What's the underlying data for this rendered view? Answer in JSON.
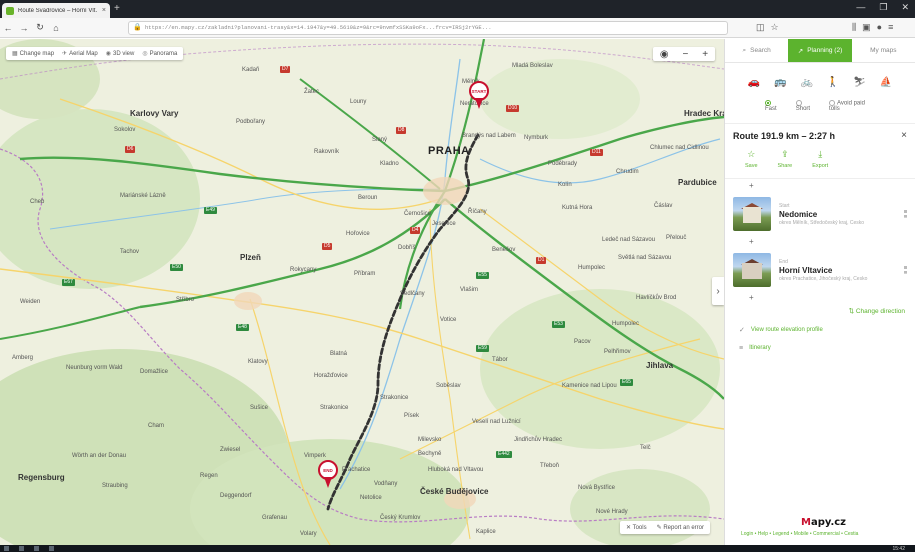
{
  "browser": {
    "tab_title": "Route Švadrovice – Horní Vlt…",
    "close_tab": "×",
    "new_tab": "+",
    "url": "https://en.mapy.cz/zakladni?planovani-trasy&x=14.1947&y=49.5610&z=9&rc=9nvmfxSSKa9oFx...frcv=IRSj2rYGE...",
    "window_controls": [
      "—",
      "❐",
      "✕"
    ]
  },
  "map": {
    "toolbar": [
      {
        "icon": "▦",
        "label": "Change map"
      },
      {
        "icon": "✈",
        "label": "Aerial Map"
      },
      {
        "icon": "◉",
        "label": "3D view"
      },
      {
        "icon": "◎",
        "label": "Panorama"
      }
    ],
    "zoom": {
      "layers": "◉",
      "minus": "−",
      "plus": "+"
    },
    "collapse_arrow": "›",
    "bottom_tools": [
      {
        "icon": "✕",
        "label": "Tools"
      },
      {
        "icon": "✎",
        "label": "Report an error"
      }
    ],
    "pins": {
      "start": "START",
      "end": "END"
    },
    "capital": "PRAHA",
    "cities": [
      {
        "name": "Karlovy Vary"
      },
      {
        "name": "Plzeň"
      },
      {
        "name": "České Budějovice"
      },
      {
        "name": "Jihlava"
      },
      {
        "name": "Pardubice"
      },
      {
        "name": "Hradec Králové"
      },
      {
        "name": "Regensburg"
      }
    ],
    "places": [
      "Kadaň",
      "Žatec",
      "Louny",
      "Slaný",
      "Kladno",
      "Rakovník",
      "Beroun",
      "Příbram",
      "Písek",
      "Strakonice",
      "Klatovy",
      "Domažlice",
      "Sušice",
      "Tábor",
      "Benešov",
      "Kolín",
      "Kutná Hora",
      "Pelhřimov",
      "Jindřichův Hradec",
      "Mladá Boleslav",
      "Mělník",
      "Neratovice",
      "Brandýs nad Labem",
      "Podbořany",
      "Sokolov",
      "Cheb",
      "Mariánské Lázně",
      "Tachov",
      "Stříbro",
      "Rokycany",
      "Horažďovice",
      "Vimperk",
      "Prachatice",
      "Strakonice",
      "Blatná",
      "Vlašim",
      "Votice",
      "Sedlčany",
      "Dobříš",
      "Nymburk",
      "Poděbrady",
      "Chrudim",
      "Havlíčkův Brod",
      "Humpolec",
      "Pacov",
      "Kamenice nad Lipou",
      "Soběslav",
      "Veselí nad Lužnicí",
      "Třeboň",
      "Nové Hrady",
      "Český Krumlov",
      "Weiden",
      "Amberg",
      "Cham",
      "Straubing",
      "Deggendorf",
      "Neunburg vorm Wald",
      "Wörth an der Donau",
      "Zwiesel",
      "Regen",
      "Grafenau",
      "Hořovice",
      "Jesenice",
      "Černošice",
      "Říčany",
      "Vodňany",
      "Milevsko",
      "Bechyně",
      "Hluboká nad Vltavou",
      "Netolice",
      "Volary",
      "Kaplice",
      "Nová Bystřice",
      "Telč",
      "Humpolec",
      "Světlá nad Sázavou",
      "Ledeč nad Sázavou",
      "Čáslav",
      "Přelouč",
      "Chlumec nad Cidlinou"
    ],
    "roads": [
      "D7",
      "D8",
      "D5",
      "D1",
      "D4",
      "D6",
      "D10",
      "D11",
      "E49",
      "E50",
      "E48",
      "E55",
      "E53",
      "E59",
      "E65",
      "E442",
      "E67"
    ]
  },
  "panel": {
    "tabs": [
      {
        "icon": "⌕",
        "label": "Search"
      },
      {
        "icon": "↗",
        "label": "Planning (2)"
      },
      {
        "icon": "",
        "label": "My maps"
      }
    ],
    "modes": [
      "🚗",
      "🚌",
      "🚲",
      "🚶",
      "⛷",
      "⛵"
    ],
    "options": [
      {
        "label": "Fast",
        "selected": true
      },
      {
        "label": "Short",
        "selected": false
      },
      {
        "label": "Avoid paid tolls",
        "selected": false
      }
    ],
    "route_title": "Route 191.9 km – 2:27 h",
    "close": "×",
    "actions": [
      {
        "icon": "☆",
        "label": "Save"
      },
      {
        "icon": "⇪",
        "label": "Share"
      },
      {
        "icon": "⤓",
        "label": "Export"
      }
    ],
    "add_stop": "+",
    "stops": [
      {
        "kind": "Start",
        "name": "Nedomice",
        "address": "okres Mělník, Středočeský kraj, Česko"
      },
      {
        "kind": "End",
        "name": "Horní Vltavice",
        "address": "okres Prachatice, Jihočeský kraj, Česko"
      }
    ],
    "change_direction": "Change direction",
    "change_icon": "⇅",
    "links": [
      {
        "icon": "✓",
        "label": "View route elevation profile"
      },
      {
        "icon": "≡",
        "label": "Itinerary"
      }
    ],
    "brand_prefix": "M",
    "brand_main": "apy.cz",
    "footer": "Login • Help • Legend • Mobile • Commercial • Cestia"
  },
  "taskbar": {
    "clock": "15:42"
  }
}
